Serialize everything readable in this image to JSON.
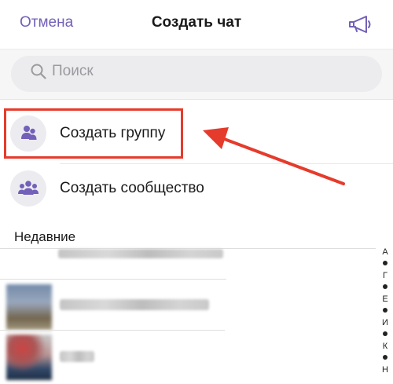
{
  "header": {
    "cancel_label": "Отмена",
    "title": "Создать чат",
    "broadcast_icon": "megaphone-icon"
  },
  "search": {
    "placeholder": "Поиск",
    "value": "",
    "icon": "search-icon"
  },
  "actions": [
    {
      "label": "Создать группу",
      "icon": "group-icon"
    },
    {
      "label": "Создать сообщество",
      "icon": "community-icon"
    }
  ],
  "recent": {
    "section_title": "Недавние"
  },
  "alphabet_index": [
    "А",
    "Г",
    "Е",
    "И",
    "К",
    "Н"
  ],
  "colors": {
    "accent": "#7360b8",
    "highlight": "#e53b2c",
    "icon_bg": "#ececf0"
  }
}
